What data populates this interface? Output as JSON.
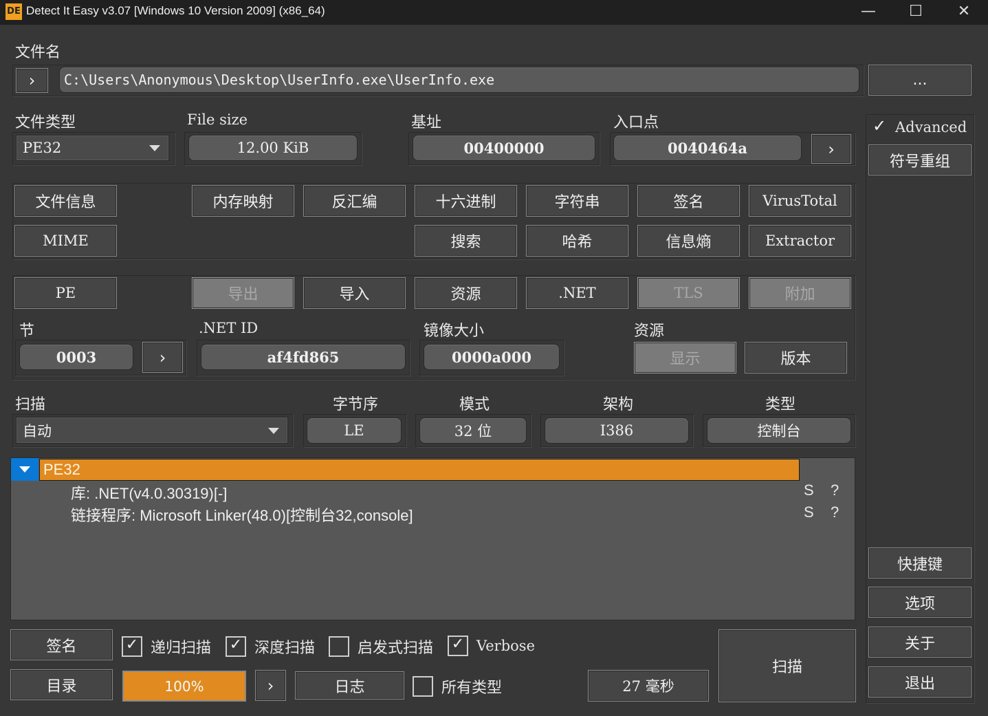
{
  "window": {
    "title": "Detect It Easy v3.07 [Windows 10 Version 2009] (x86_64)",
    "icon_text": "DE",
    "minimize": "—",
    "maximize": "☐",
    "close": "✕"
  },
  "file": {
    "label": "文件名",
    "path": "C:\\Users\\Anonymous\\Desktop\\UserInfo.exe\\UserInfo.exe",
    "browse": "...",
    "go": "›"
  },
  "info": {
    "file_type_label": "文件类型",
    "file_type": "PE32",
    "size_label": "File size",
    "size": "12.00 KiB",
    "base_label": "基址",
    "base": "00400000",
    "entry_label": "入口点",
    "entry": "0040464a",
    "entry_go": "›"
  },
  "advanced": {
    "label": "Advanced",
    "checked": "✓",
    "symbols_btn": "符号重组"
  },
  "tools": {
    "row1": [
      "文件信息",
      "内存映射",
      "反汇编",
      "十六进制",
      "字符串",
      "签名",
      "VirusTotal"
    ],
    "row2": [
      "MIME",
      "搜索",
      "哈希",
      "信息熵",
      "Extractor"
    ]
  },
  "pe": {
    "pe": "PE",
    "exports": "导出",
    "imports": "导入",
    "resources": "资源",
    "dotnet": ".NET",
    "tls": "TLS",
    "overlay": "附加",
    "sections_label": "节",
    "sections": "0003",
    "sections_go": "›",
    "netid_label": ".NET ID",
    "netid": "af4fd865",
    "image_size_label": "镜像大小",
    "image_size": "0000a000",
    "res_label": "资源",
    "res_show": "显示",
    "res_version": "版本"
  },
  "scan": {
    "label": "扫描",
    "mode_value": "自动",
    "endian_label": "字节序",
    "endian": "LE",
    "mode_label": "模式",
    "mode": "32 位",
    "arch_label": "架构",
    "arch": "I386",
    "type_label": "类型",
    "type": "控制台"
  },
  "results": {
    "root": "PE32",
    "items": [
      {
        "text": "库: .NET(v4.0.30319)[-]",
        "s": "S",
        "q": "?"
      },
      {
        "text": "链接程序: Microsoft Linker(48.0)[控制台32,console]",
        "s": "S",
        "q": "?"
      }
    ]
  },
  "bottom": {
    "signatures": "签名",
    "directory": "目录",
    "recursive": "递归扫描",
    "deep": "深度扫描",
    "heuristic": "启发式扫描",
    "verbose": "Verbose",
    "all_types": "所有类型",
    "progress": "100%",
    "progress_value": 100,
    "next": "›",
    "log": "日志",
    "time": "27 毫秒",
    "scan": "扫描",
    "check": "✓"
  },
  "side": {
    "shortcuts": "快捷键",
    "options": "选项",
    "about": "关于",
    "exit": "退出"
  },
  "colors": {
    "accent": "#e08a20",
    "tree_selected": "#0a78d4"
  }
}
